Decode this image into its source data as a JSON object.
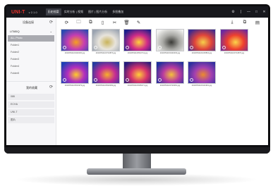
{
  "app": {
    "logo": "UNI-T",
    "version": "v 2.1.0",
    "menu": [
      "历史档案",
      "实时分析 | 视频",
      "图片 | 图片分析",
      "多图叠加"
    ],
    "window_controls": [
      "⚙",
      "|",
      "—",
      "□",
      "✕"
    ]
  },
  "sidebar": {
    "device_title": "设备连接",
    "group": "UTi85Q",
    "folders": [
      "ALL Photo",
      "Folder1",
      "Folder2",
      "Folder3",
      "Folder4",
      "Folder5"
    ],
    "favorites_title": "我的收藏",
    "favorites": [
      "086",
      "ECHA",
      "UNI-T",
      "图片"
    ]
  },
  "toolbar": {
    "icons": [
      "refresh-icon",
      "folder-open-icon",
      "copy-icon",
      "document-icon",
      "cut-icon",
      "trash-icon",
      "edit-icon"
    ],
    "right_icons": [
      "download-icon",
      "copy-right-icon",
      "report-icon"
    ]
  },
  "gallery": {
    "row1": [
      {
        "name": "20230531100440030.jpg",
        "palette": "#2a4ab0,#c63db2,#f5a01f"
      },
      {
        "name": "20230531100710876.jpg",
        "palette": "#9aa3b0,#e8e4dc,#c9b35a"
      },
      {
        "name": "20230531160510711.jpg",
        "palette": "#1b1f8a,#d22b88,#ffd23a"
      },
      {
        "name": "20230531150440003.jpg",
        "palette": "#f1f1ef,#a8a8a4,#3a3a36"
      },
      {
        "name": "20230531161025864.jpg",
        "palette": "#3d2a8f,#e1453a,#f6d04a"
      },
      {
        "name": "20230531160710876.jpg",
        "palette": "#6a2aa0,#ee3f2f,#fbd54a"
      }
    ],
    "row2": [
      {
        "name": "20230531160516979.jpg",
        "palette": "#1f3fb5,#b52fbd,#ffcc2a"
      },
      {
        "name": "20230531160520099.jpg",
        "palette": "#243a9e,#c42b95,#f7b02a"
      },
      {
        "name": "20230531160305471.jpg",
        "palette": "#251a7a,#d7336d,#ffcf38"
      },
      {
        "name": "20230531160720281.jpg",
        "palette": "#1f2f9c,#b93aa0,#f4c23a"
      },
      {
        "name": "20230531160121991.jpg",
        "palette": "#2d2f9e,#a43fb0,#ec8b2d"
      }
    ]
  }
}
